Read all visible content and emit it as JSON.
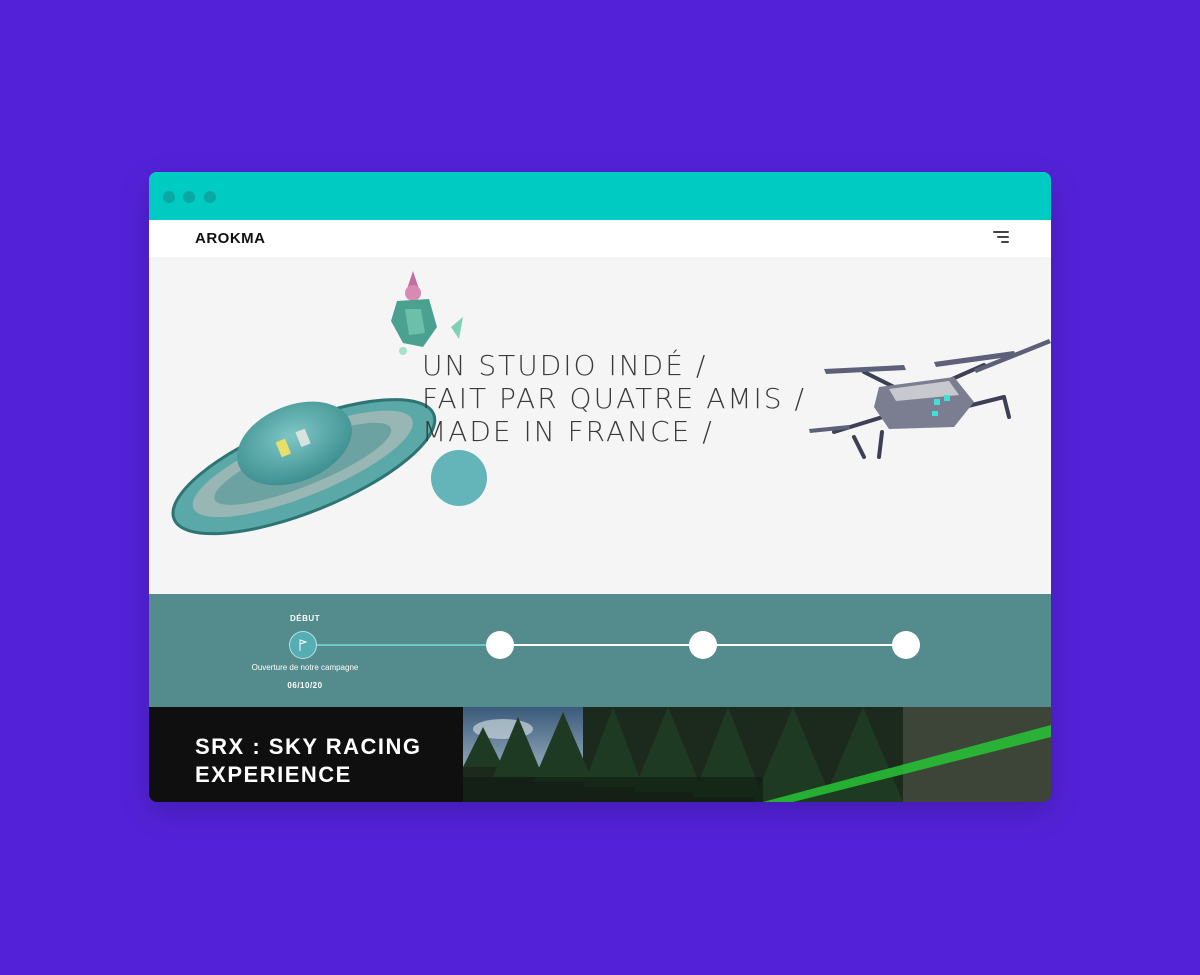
{
  "brand": {
    "logo": "AROKMA"
  },
  "hero": {
    "lines": [
      "UN STUDIO INDÉ /",
      "FAIT PAR QUATRE AMIS /",
      "MADE IN FRANCE /"
    ]
  },
  "timeline": {
    "start_label": "DÉBUT",
    "event_text": "Ouverture de notre campagne",
    "event_date": "06/10/20",
    "progress_fraction": 0.3
  },
  "featured": {
    "title": "SRX : SKY RACING\nEXPERIENCE"
  },
  "colors": {
    "background": "#5322d8",
    "titlebar": "#00cbc3",
    "timeline_bg": "#548b8c",
    "accent": "#55aeb3"
  },
  "icons": {
    "menu": "menu-lines-icon",
    "flag": "flag-icon"
  }
}
